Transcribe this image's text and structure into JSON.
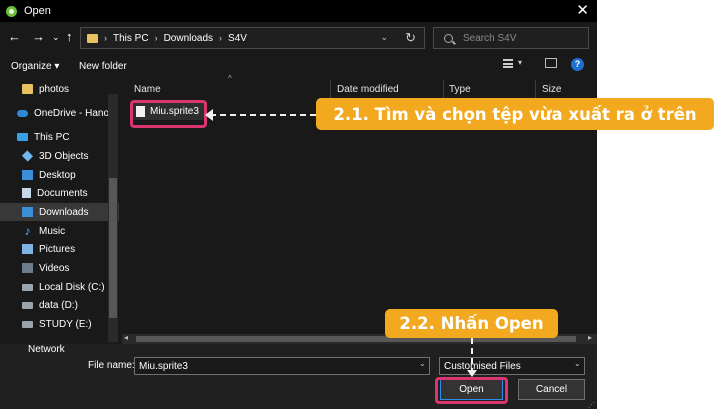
{
  "window": {
    "title": "Open",
    "close_glyph": "✕"
  },
  "nav": {
    "back": "←",
    "forward": "→",
    "dropdown": "⌄",
    "up": "↑"
  },
  "address": {
    "crumb_sep": "›",
    "crumbs": [
      "This PC",
      "Downloads",
      "S4V"
    ],
    "dropdown_glyph": "⌄",
    "refresh_glyph": "↻"
  },
  "search": {
    "placeholder": "Search S4V"
  },
  "toolbar": {
    "organize": "Organize ▾",
    "new_folder": "New folder",
    "view_dropdown": "▾",
    "help": "?"
  },
  "sidebar": {
    "items": [
      {
        "label": "photos",
        "icon": "folder-icon"
      },
      {
        "label": "OneDrive - Hanoi",
        "icon": "cloud-icon"
      },
      {
        "label": "This PC",
        "icon": "computer-icon"
      },
      {
        "label": "3D Objects",
        "icon": "cube-icon"
      },
      {
        "label": "Desktop",
        "icon": "desktop-icon"
      },
      {
        "label": "Documents",
        "icon": "document-icon"
      },
      {
        "label": "Downloads",
        "icon": "download-icon"
      },
      {
        "label": "Music",
        "icon": "music-icon"
      },
      {
        "label": "Pictures",
        "icon": "picture-icon"
      },
      {
        "label": "Videos",
        "icon": "video-icon"
      },
      {
        "label": "Local Disk (C:)",
        "icon": "drive-icon"
      },
      {
        "label": "data (D:)",
        "icon": "drive-icon"
      },
      {
        "label": "STUDY (E:)",
        "icon": "drive-icon"
      }
    ],
    "selected": "Downloads",
    "network": "Network"
  },
  "columns": {
    "name": "Name",
    "date": "Date modified",
    "type": "Type",
    "size": "Size",
    "sort_caret": "^"
  },
  "files": [
    {
      "name": "Miu.sprite3"
    }
  ],
  "scrollbar": {
    "left": "◂",
    "right": "▸"
  },
  "bottom": {
    "file_name_label": "File name:",
    "file_name_value": "Miu.sprite3",
    "filter_value": "Customised Files",
    "dropdown_glyph": "⌄",
    "open_label": "Open",
    "cancel_label": "Cancel",
    "grip": "⋰"
  },
  "annotations": {
    "step1": "2.1. Tìm và chọn tệp vừa xuất ra ở trên",
    "step2": "2.2. Nhấn Open"
  },
  "colors": {
    "callout": "#f2a81f",
    "highlight": "#d93570",
    "accent": "#2e8be6"
  }
}
